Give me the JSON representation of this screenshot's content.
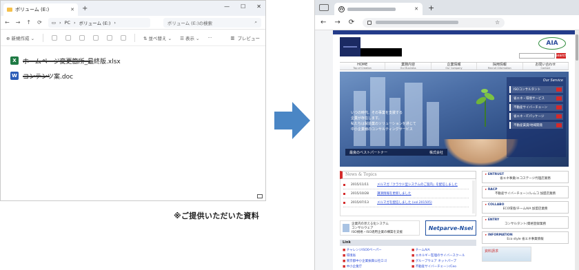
{
  "explorer": {
    "tab_title": "ボリューム (E:)",
    "address": [
      "PC",
      "ボリューム (E:)"
    ],
    "search_placeholder": "ボリューム (E:)の検索",
    "toolbar": {
      "new": "新規作成",
      "sort": "並べ替え",
      "view": "表示",
      "preview": "プレビュー"
    },
    "files": [
      {
        "name": "ホームページ変更箇所_最終版.xlsx",
        "type": "excel"
      },
      {
        "name": "コンテンツ案.doc",
        "type": "word"
      }
    ]
  },
  "caption": "※ご提供いただいた資料",
  "arrow": {
    "color": "#4a86c5"
  },
  "browser": {
    "tab_icon": "wordpress-icon",
    "site": {
      "menu": [
        {
          "label": "HOME",
          "sub": "Top of Creation"
        },
        {
          "label": "業務内容",
          "sub": "Our Business"
        },
        {
          "label": "企業情報",
          "sub": "Our Company"
        },
        {
          "label": "採用情報",
          "sub": "Recruit Information"
        },
        {
          "label": "お問い合わせ",
          "sub": "Contact"
        }
      ],
      "logo_text": "AIA",
      "search_button": "Search",
      "hero_lines": [
        "いつの時代、その事業を支援する",
        "企業が存在します。",
        "私たちは製造業のソリューションを通じて",
        "中小企業様のコンサルティングサービス"
      ],
      "hero_bar": {
        "left": "最良のベストパートナー",
        "right": "株式会社"
      },
      "hero_panel_title": "Our Service",
      "hero_panel_items": [
        "ISOコンサルタント",
        "省エネ・環境サービス",
        "不動産サイバーチェーン",
        "省エネ・ITパッケージ",
        "不動産賃貸/地域開発"
      ],
      "news_title": "News & Topics",
      "news": [
        {
          "date": "2015/11/11",
          "text": "メルマガ『クラウド型システムのご案内』を配信しました"
        },
        {
          "date": "2015/10/28",
          "text": "講演情報を更新しました"
        },
        {
          "date": "2015/07/13",
          "text": "メルマガを配信しました (vol.201505)"
        }
      ],
      "banner_text": [
        "企業内の見える化システム",
        "コンサルウェア",
        "ISO規格・ISO適用企業の構築を支援"
      ],
      "banner_brand": "Netparve-Nsei",
      "links_title": "Link",
      "links": [
        "チャレンジISO0ペーパー",
        "チームAIA",
        "環境省",
        "エネルギー監理のサイバースクール",
        "東京都中小企業振興公社ロゴ",
        "グループウェア ネットパーブ",
        "中小企業庁",
        "不動産サイバーチェーン/Ceo"
      ],
      "side": [
        {
          "h": "ENTRUST",
          "d": "省エネ事業/エコステージ代理店業務"
        },
        {
          "h": "RACP",
          "d": "不動産サイバーチェーン/レムコ 加盟店業務"
        },
        {
          "h": "COLLABO",
          "d": "ECO環境/チームAIA 加盟店業務"
        },
        {
          "h": "ENTRY",
          "d": "コンサルタント/資格登録業務"
        },
        {
          "h": "INFORMATION",
          "d": "Eco style 省エネ事業情報"
        }
      ],
      "side_banner": "資料請求"
    }
  }
}
